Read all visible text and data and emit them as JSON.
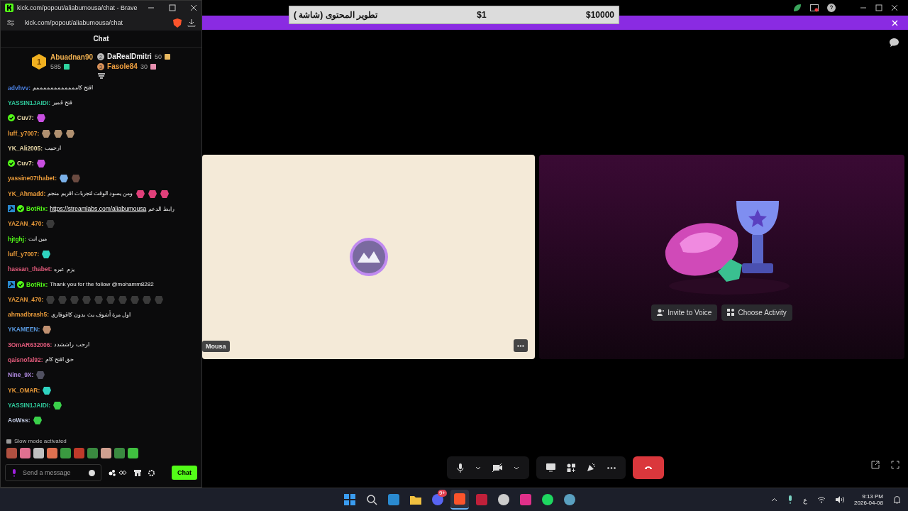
{
  "browser": {
    "title": "kick.com/popout/aliabumousa/chat - Brave",
    "url": "kick.com/popout/aliabumousa/chat"
  },
  "chat": {
    "header": "Chat",
    "leaders": [
      {
        "rank": "1",
        "name": "Abuadnan90",
        "count": "585",
        "color": "#2fd3a0"
      },
      {
        "rank": "2",
        "name": "DaRealDmitri",
        "count": "50",
        "color": "#e8b860"
      },
      {
        "rank": "3",
        "name": "Fasole84",
        "count": "30",
        "color": "#e890b0"
      }
    ],
    "messages": [
      {
        "user": "advhvv:",
        "color": "#4a7fe0",
        "text": "افتح كاممممممممممممم"
      },
      {
        "user": "YASSIN1JAIDI:",
        "color": "#2fc79a",
        "text": "فتح قمير"
      },
      {
        "user": "Cuv7:",
        "color": "#e8d8a8",
        "badges": [
          {
            "kind": "verified"
          }
        ],
        "emotes": [
          {
            "color": "#c84fe0"
          }
        ]
      },
      {
        "user": "luff_y7007:",
        "color": "#e89a3a",
        "emotes": [
          {
            "color": "#b09070"
          },
          {
            "color": "#b09070"
          },
          {
            "color": "#b09070"
          }
        ]
      },
      {
        "user": "YK_Ali2005:",
        "color": "#e8d8a8",
        "text": "ارحبيب"
      },
      {
        "user": "Cuv7:",
        "color": "#e8d8a8",
        "badges": [
          {
            "kind": "verified"
          }
        ],
        "emotes": [
          {
            "color": "#c84fe0"
          }
        ]
      },
      {
        "user": "yassine07thabet:",
        "color": "#e89a3a",
        "emotes": [
          {
            "color": "#7ab0e8"
          },
          {
            "color": "#6a4a40"
          }
        ]
      },
      {
        "user": "YK_Ahmadd:",
        "color": "#e89a3a",
        "text": "ومن يسود الوقت لتجربات اقريم منجم",
        "emotes": [
          {
            "color": "#e0407a"
          },
          {
            "color": "#e0407a"
          },
          {
            "color": "#e0407a"
          }
        ]
      },
      {
        "user": "BotRix:",
        "color": "#53fc18",
        "badges": [
          {
            "kind": "bot"
          },
          {
            "kind": "verified"
          }
        ],
        "link": "https://streamlabs.com/aliabumousa",
        "text": "رابط الدعم"
      },
      {
        "user": "YAZAN_470:",
        "color": "#e89a3a",
        "emotes": [
          {
            "color": "#3a3a3a"
          }
        ]
      },
      {
        "user": "hjtghj:",
        "color": "#53fc18",
        "text": "مين انت"
      },
      {
        "user": "luff_y7007:",
        "color": "#e89a3a",
        "emotes": [
          {
            "color": "#2fd3c0"
          }
        ]
      },
      {
        "user": "hassan_thabet:",
        "color": "#e05a7a",
        "text": "يزم عبره"
      },
      {
        "user": "BotRix:",
        "color": "#53fc18",
        "badges": [
          {
            "kind": "bot"
          },
          {
            "kind": "verified"
          }
        ],
        "text": "Thank you for the follow @mohamm8282"
      },
      {
        "user": "YAZAN_470:",
        "color": "#e89a3a",
        "emotes": [
          {
            "color": "#3a3a3a"
          },
          {
            "color": "#3a3a3a"
          },
          {
            "color": "#3a3a3a"
          },
          {
            "color": "#3a3a3a"
          },
          {
            "color": "#3a3a3a"
          },
          {
            "color": "#3a3a3a"
          },
          {
            "color": "#3a3a3a"
          },
          {
            "color": "#3a3a3a"
          },
          {
            "color": "#3a3a3a"
          },
          {
            "color": "#3a3a3a"
          }
        ]
      },
      {
        "user": "ahmadbrash5:",
        "color": "#e89a3a",
        "text": "اول مرة أشوف بث بدون كاقوفاري"
      },
      {
        "user": "YKAMEEN:",
        "color": "#5a9ae0",
        "emotes": [
          {
            "color": "#c09070"
          }
        ]
      },
      {
        "user": "3OmAR632006:",
        "color": "#e05a7a",
        "text": "ارحب راششدد"
      },
      {
        "user": "qaisnofal92:",
        "color": "#e05a7a",
        "text": "حق افتح كام"
      },
      {
        "user": "Nine_9X:",
        "color": "#b08ae0",
        "emotes": [
          {
            "color": "#505060"
          }
        ]
      },
      {
        "user": "YK_OMAR:",
        "color": "#e89a3a",
        "emotes": [
          {
            "color": "#2fd3c0"
          }
        ]
      },
      {
        "user": "YASSIN1JAIDI:",
        "color": "#2fc79a",
        "emotes": [
          {
            "color": "#3ad04a"
          }
        ]
      },
      {
        "user": "AoWss:",
        "color": "#c0c8e0",
        "emotes": [
          {
            "color": "#3ad04a"
          }
        ]
      }
    ],
    "notice": "Slow mode activated",
    "quick_emotes": [
      {
        "color": "#b05040"
      },
      {
        "color": "#e07090"
      },
      {
        "color": "#c0c0c0"
      },
      {
        "color": "#e07050"
      },
      {
        "color": "#3a9a40"
      },
      {
        "color": "#c03a2a"
      },
      {
        "color": "#3a8a40"
      },
      {
        "color": "#d0a090"
      },
      {
        "color": "#3a8a40"
      },
      {
        "color": "#40c040"
      }
    ],
    "input": {
      "placeholder": "Send a message"
    },
    "send_button": "Chat"
  },
  "overlay": {
    "title": "تطوير المحتوى (شاشة )",
    "price": "$1",
    "goal": "$10000"
  },
  "call": {
    "name_tag": "Mousa",
    "actions": [
      "Invite to Voice",
      "Choose Activity"
    ]
  },
  "taskbar": {
    "apps": [
      {
        "kind": "start",
        "selected": false
      },
      {
        "kind": "search",
        "selected": false
      },
      {
        "kind": "store",
        "selected": false
      },
      {
        "kind": "files",
        "selected": false
      },
      {
        "kind": "discord",
        "selected": false,
        "badge": "9+"
      },
      {
        "kind": "brave",
        "selected": true
      },
      {
        "kind": "app-a",
        "selected": false
      },
      {
        "kind": "obs",
        "selected": false
      },
      {
        "kind": "iptv",
        "selected": false
      },
      {
        "kind": "spotify",
        "selected": false
      },
      {
        "kind": "app-b",
        "selected": false
      }
    ],
    "language": "ع",
    "time": "9:13 PM",
    "date": "2026-04-08"
  }
}
